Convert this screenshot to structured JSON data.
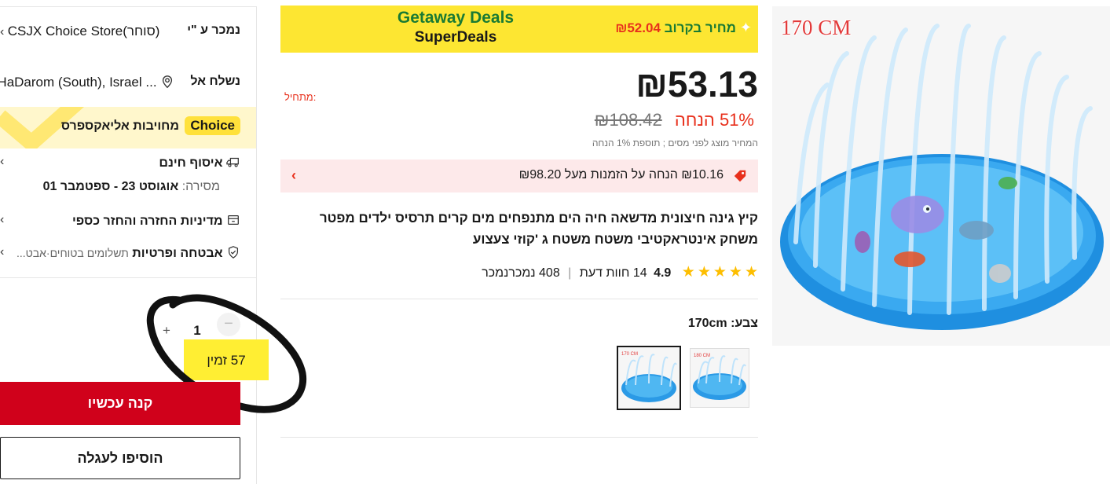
{
  "sidebar": {
    "sold_by_label": "נמכר ע \"י",
    "store_name": "CSJX Choice Store(סוחר)",
    "ship_to_label": "נשלח אל",
    "ship_to_value": "HaDarom (South), Israel ...",
    "choice_badge": "Choice",
    "choice_commitment": "מחויבות אליאקספרס",
    "free_pickup": "איסוף חינם",
    "delivery_label": "מסירה:",
    "delivery_value": "אוגוסט 23 - ספטמבר 01",
    "returns": "מדיניות החזרה והחזר כספי",
    "security": "אבטחה ופרטיות",
    "security_sub": "תשלומים בטוחים·אבט...",
    "qty_minus": "−",
    "qty_value": "1",
    "qty_plus": "+",
    "stock_note": "57 זמין",
    "buy_now": "קנה עכשיו",
    "add_to_cart": "הוסיפו לעגלה"
  },
  "banner": {
    "title_line1": "Getaway Deals",
    "title_line2": "SuperDeals",
    "soon_label": "מחיר בקרוב",
    "soon_price": "₪52.04",
    "spark": "✦"
  },
  "price": {
    "current": "₪53.13",
    "from_label": "מתחיל:",
    "original": "₪108.42",
    "discount": "51% הנחה",
    "tax_note": "המחיר מוצג לפני מסים ; תוספת 1% הנחה"
  },
  "coupon": {
    "text": "₪10.16 הנחה על הזמנות מעל ₪98.20",
    "chevron": "‹"
  },
  "product": {
    "title": "קיץ גינה חיצונית מדשאה חיה הים מתנפחים מים קרים תרסיס ילדים מפטר משחק אינטראקטיבי משטח משטח ג 'קוזי צעצוע",
    "rating": "4.9",
    "reviews": "14 חוות דעת",
    "sold": "408 נמכרנמכר",
    "color_label": "צבע:",
    "color_value": "170cm",
    "image_size_label": "170 CM",
    "thumb_1_label": "180 CM",
    "thumb_2_label": "170 CM"
  },
  "colors": {
    "accent_red": "#d0011b",
    "promo_yellow": "#fde632",
    "choice_yellow": "#ffe13b",
    "coupon_bg": "#fde9ea",
    "star": "#fdbe00"
  }
}
